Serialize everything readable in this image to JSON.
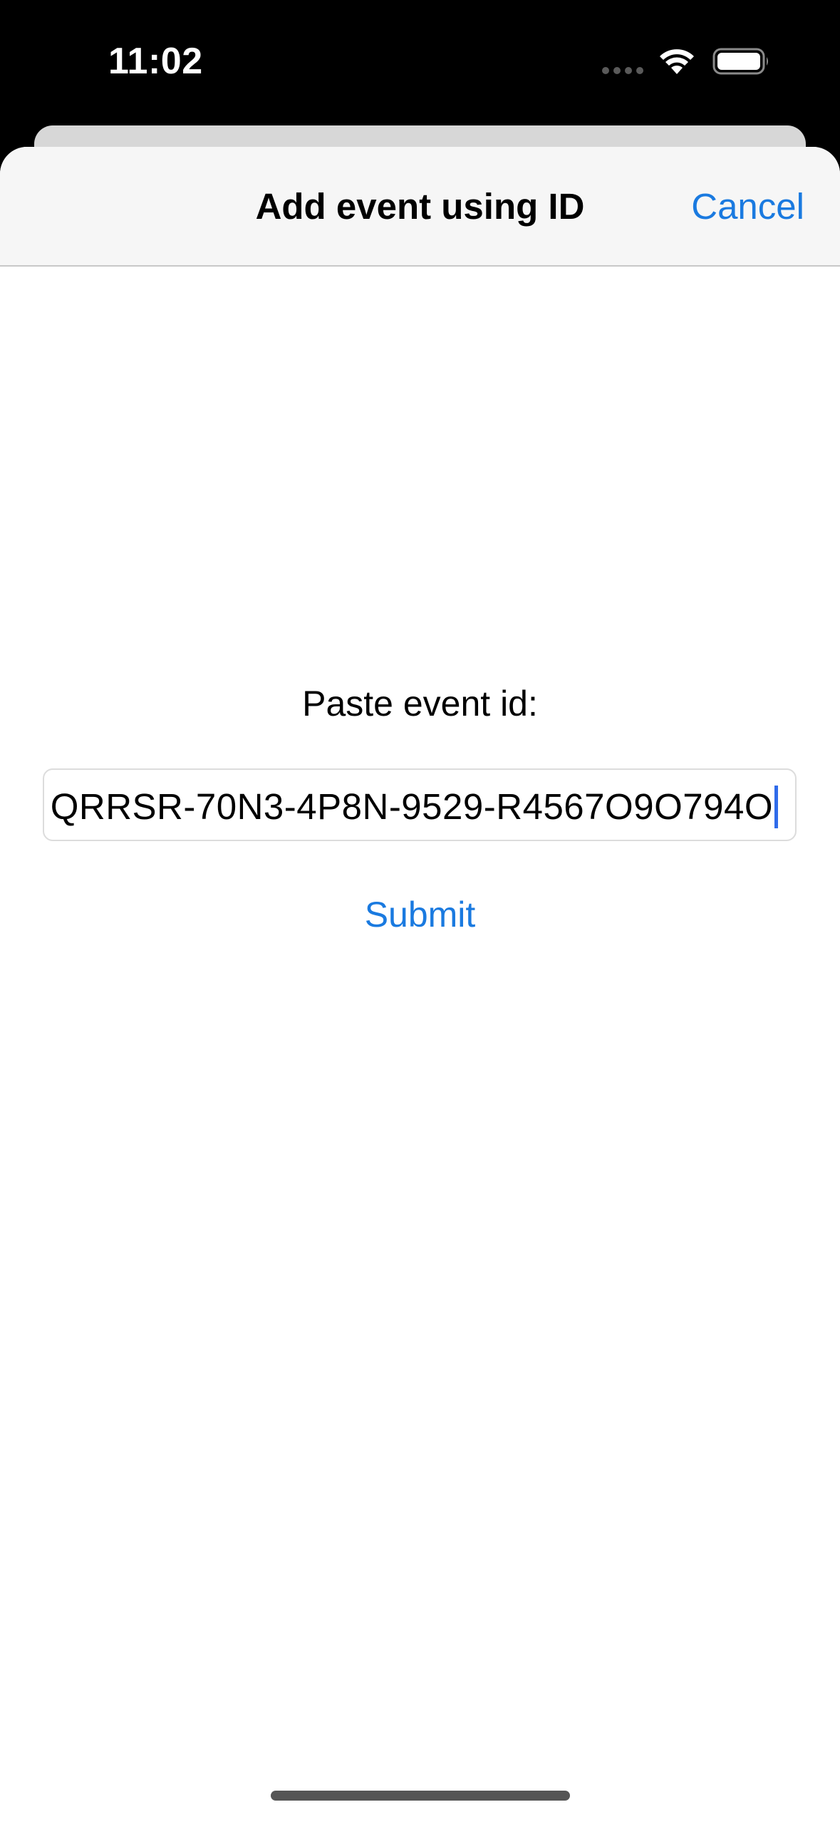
{
  "status_bar": {
    "time": "11:02",
    "icons": [
      "signal-dots-icon",
      "wifi-icon",
      "battery-icon"
    ]
  },
  "nav": {
    "title": "Add event using ID",
    "cancel_label": "Cancel"
  },
  "form": {
    "prompt": "Paste event id:",
    "id_value": "QRRSR-70N3-4P8N-9529-R4567O9O794O",
    "submit_label": "Submit"
  },
  "colors": {
    "accent": "#1a7ae0",
    "caret": "#2f6bea",
    "status_bar_bg": "#000000",
    "nav_bg": "#f6f6f6"
  }
}
